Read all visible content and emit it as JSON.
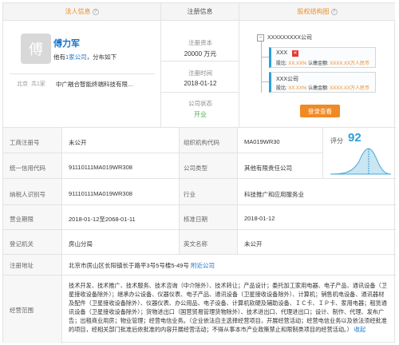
{
  "headers": {
    "legal_rep": "法人信息",
    "registration": "注册信息",
    "equity": "股权结构图"
  },
  "legal_rep": {
    "avatar_char": "傅",
    "name": "傅力军",
    "companies_prefix": "他有",
    "companies_count": "1家公司",
    "companies_suffix": "，分布如下",
    "region": "北京",
    "count": "共1家",
    "company": "中广融合智能终端科技有限…"
  },
  "registration": {
    "capital_label": "注册资本",
    "capital_value": "20000 万元",
    "date_label": "注册时间",
    "date_value": "2018-01-12",
    "status_label": "公司状态",
    "status_value": "开业"
  },
  "equity": {
    "root": "XXXXXXXXX公司",
    "holder1_name": "XXX",
    "holder1_ratio_label": "股比:",
    "holder1_ratio": "XX.XX%",
    "holder1_amount_label": "认缴金额:",
    "holder1_amount": "XXXX.XX万人民币",
    "holder2_name": "XXX公司",
    "holder2_ratio_label": "股比:",
    "holder2_ratio": "XX.XX%",
    "holder2_amount_label": "认缴金额:",
    "holder2_amount": "XXXX.XX万人民币",
    "button": "登录查看"
  },
  "table": {
    "business_reg_no_label": "工商注册号",
    "business_reg_no": "未公开",
    "org_code_label": "组织机构代码",
    "org_code": "MA019WR30",
    "credit_code_label": "统一信用代码",
    "credit_code": "91110111MA019WR308",
    "company_type_label": "公司类型",
    "company_type": "其他有限责任公司",
    "taxpayer_id_label": "纳税人识别号",
    "taxpayer_id": "91110111MA019WR308",
    "industry_label": "行业",
    "industry": "科技推广和应用服务业",
    "term_label": "营业期限",
    "term": "2018-01-12至2068-01-11",
    "approval_date_label": "核准日期",
    "approval_date": "2018-01-12",
    "authority_label": "登记机关",
    "authority": "房山分局",
    "english_name_label": "英文名称",
    "english_name": "未公开",
    "address_label": "注册地址",
    "address": "北京市房山区长阳镇长于路平3号5号楼5-49号",
    "address_link": "附近公司",
    "scope_label": "经营范围",
    "scope_text": "技术开发、技术推广、技术服务、技术咨询（中介除外）、技术转让；产品设计；委托加工家用电器、电子产品、通讯设备（卫星接收设备除外）；继承办公设备、仪器仪表、电子产品、通讯设备（卫星接收设备除外）、计算机；销售机电设备、通讯器材及配件（卫星接收设备除外）、仪器仪表、办公用品、电子设备、计算机软硬及辅助设备、ＩＣ卡、ＩＰ卡、家用电器；租赁通讯设备（卫星接收设备除外）；货物进出口（国营贸易管理货物除外）、技术进出口、代理进出口；设计、制作、代理、发布广告；出租商业用房；物业管理；经营电信业务。（企业依法自主选择经营项目，开展经营活动；经营电信业务以及依法须经批准的项目，经相关部门批准后依批准的内容开展经营活动；不得从事本市产业政策禁止和限制类项目的经营活动。）",
    "scope_link": "收起"
  },
  "score": {
    "label": "评分",
    "value": "92"
  }
}
